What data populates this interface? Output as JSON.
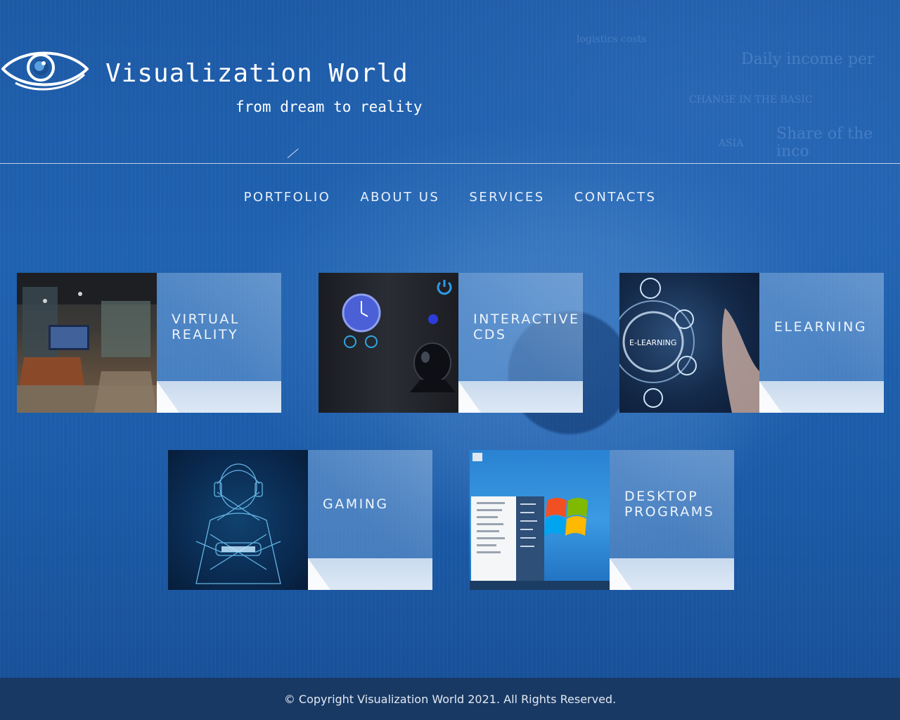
{
  "brand": {
    "title": "Visualization World",
    "tagline": "from dream to reality",
    "logo_icon": "eye-logo-icon"
  },
  "nav": {
    "items": [
      {
        "label": "PORTFOLIO"
      },
      {
        "label": "ABOUT US"
      },
      {
        "label": "SERVICES"
      },
      {
        "label": "CONTACTS"
      }
    ]
  },
  "background_text": {
    "t1": "Daily income per",
    "t2": "logistics costs",
    "t3": "CHANGE IN THE BASIC",
    "t4": "Share of the inco",
    "t5": "ASIA"
  },
  "cards": [
    {
      "label": "VIRTUAL\nREALITY",
      "image": "vr-living-room-image"
    },
    {
      "label": "INTERACTIVE\nCDS",
      "image": "clock-widget-image"
    },
    {
      "label": "ELEARNING",
      "image": "e-learning-image"
    },
    {
      "label": "GAMING",
      "image": "gamer-wireframe-image"
    },
    {
      "label": "DESKTOP\nPROGRAMS",
      "image": "windows-start-menu-image"
    }
  ],
  "thumb_text": {
    "elearning": "E-LEARNING"
  },
  "footer": {
    "copyright": "© Copyright Visualization World 2021. All Rights Reserved."
  },
  "colors": {
    "background": "#1f62b0",
    "footer": "#19375f",
    "text": "#ffffff"
  }
}
